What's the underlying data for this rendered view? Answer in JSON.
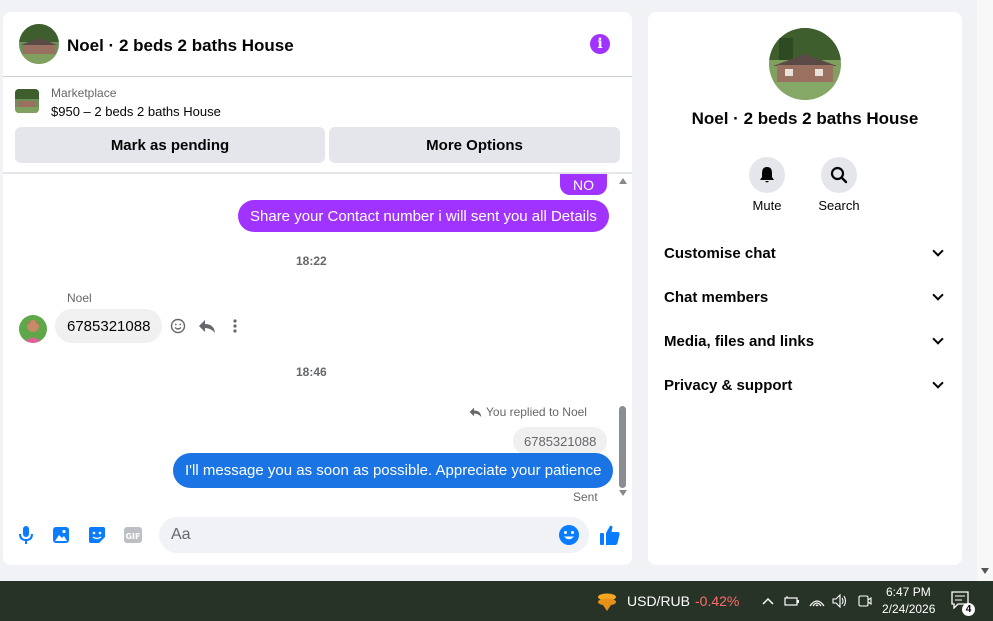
{
  "chat": {
    "title": "Noel · 2 beds 2 baths House",
    "marketplace": {
      "label": "Marketplace",
      "listing": "$950 – 2 beds 2 baths House",
      "pending_button": "Mark as pending",
      "options_button": "More Options"
    },
    "messages": {
      "partial": "NO",
      "outgoing_1": "Share your Contact number i will sent you all Details",
      "time_1": "18:22",
      "sender": "Noel",
      "incoming_1": "6785321088",
      "time_2": "18:46",
      "reply_note": "You replied to Noel",
      "quoted": "6785321088",
      "outgoing_2": "I'll message you as soon as possible. Appreciate your patience",
      "status": "Sent"
    },
    "composer": {
      "placeholder": "Aa"
    }
  },
  "details": {
    "title": "Noel · 2 beds 2 baths House",
    "actions": {
      "mute": "Mute",
      "search": "Search"
    },
    "sections": {
      "customise": "Customise chat",
      "members": "Chat members",
      "media": "Media, files and links",
      "privacy": "Privacy & support"
    }
  },
  "taskbar": {
    "stock_pair": "USD/RUB",
    "stock_change": "-0.42%",
    "time": "6:47 PM",
    "date": "2/24/2026",
    "notification_count": "4"
  },
  "colors": {
    "purple_bubble": "#a033ff",
    "blue_bubble": "#1b74e4",
    "messenger_blue": "#0a7cff",
    "negative_change": "#ff6b6b"
  },
  "icons": {
    "info": "info-icon",
    "mic": "microphone-icon",
    "photo": "photo-icon",
    "sticker": "sticker-icon",
    "gif": "gif-icon",
    "emoji": "emoji-icon",
    "like": "thumbs-up-icon",
    "mute": "bell-icon",
    "search": "search-icon"
  }
}
